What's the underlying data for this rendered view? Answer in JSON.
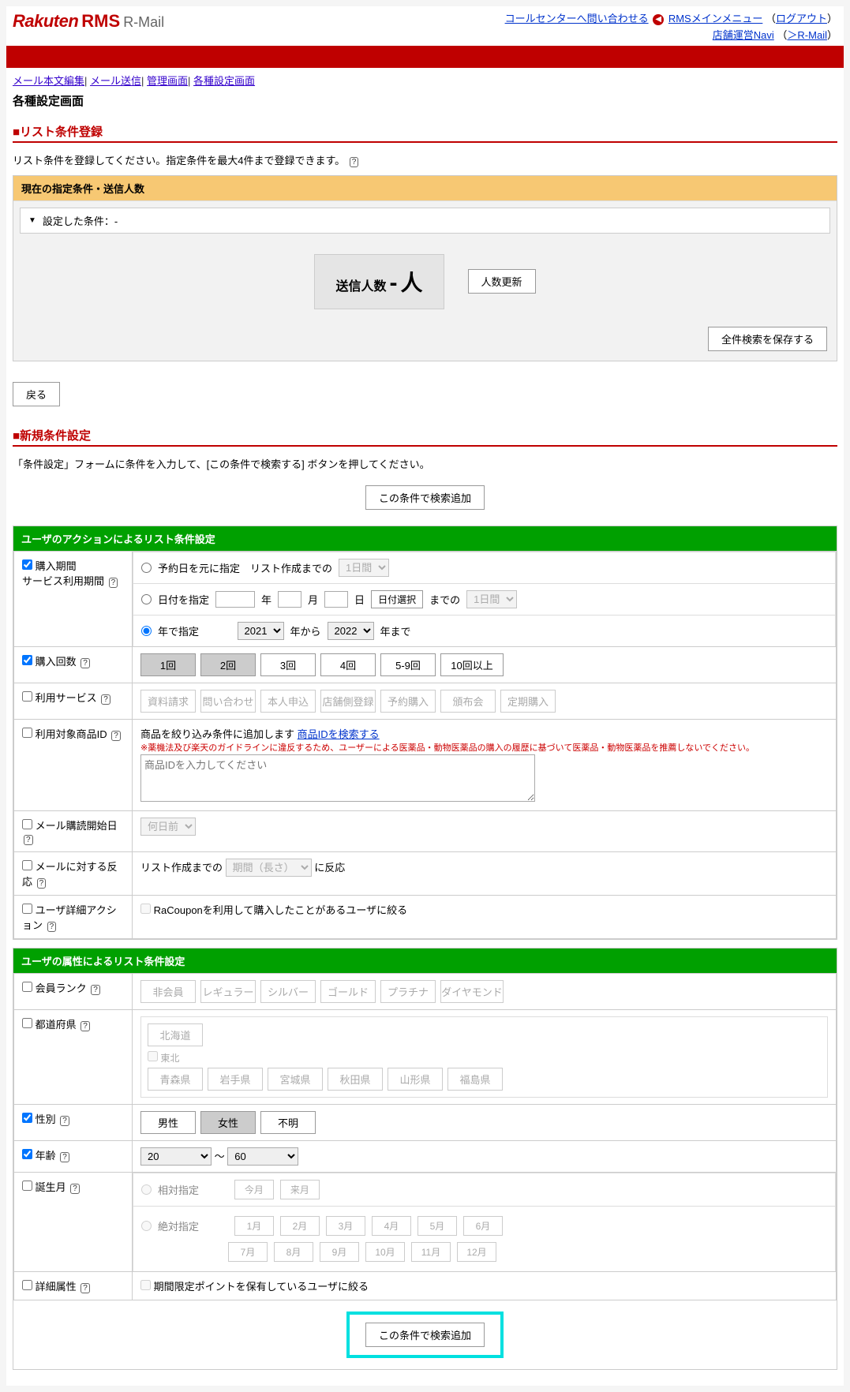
{
  "header": {
    "logo_main": "Rakuten",
    "logo_rms": "RMS",
    "logo_sub": "R-Mail",
    "link_call": "コールセンターへ問い合わせる",
    "link_menu": "RMSメインメニュー",
    "link_logout": "ログアウト",
    "link_navi": "店舗運営Navi",
    "link_rmail": "＞R-Mail"
  },
  "breadcrumb": {
    "b1": "メール本文編集",
    "b2": "メール送信",
    "b3": "管理画面",
    "b4": "各種設定画面"
  },
  "page_title": "各種設定画面",
  "sec1": {
    "title": "■リスト条件登録",
    "desc": "リスト条件を登録してください。指定条件を最大4件まで登録できます。",
    "panel_head": "現在の指定条件・送信人数",
    "cond_label": "設定した条件：-",
    "count_label": "送信人数",
    "count_value": "-",
    "count_unit": "人",
    "btn_update": "人数更新",
    "btn_save": "全件検索を保存する",
    "btn_back": "戻る"
  },
  "sec2": {
    "title": "■新規条件設定",
    "desc": "「条件設定」フォームに条件を入力して、[この条件で検索する] ボタンを押してください。",
    "btn_search": "この条件で検索追加"
  },
  "action_head": "ユーザのアクションによるリスト条件設定",
  "rows": {
    "r_period": "購入期間",
    "r_period_sub": "サービス利用期間",
    "p1_label": "予約日を元に指定　リスト作成までの",
    "p1_sel": "1日間",
    "p2_label": "日付を指定",
    "p2_y": "年",
    "p2_m": "月",
    "p2_d": "日",
    "p2_btn": "日付選択",
    "p2_until": "までの",
    "p2_sel": "1日間",
    "p3_label": "年で指定",
    "p3_y1": "2021",
    "p3_from": "年から",
    "p3_y2": "2022",
    "p3_to": "年まで",
    "r_count": "購入回数",
    "cnt": [
      "1回",
      "2回",
      "3回",
      "4回",
      "5-9回",
      "10回以上"
    ],
    "r_service": "利用サービス",
    "svc": [
      "資料請求",
      "問い合わせ",
      "本人申込",
      "店舗側登録",
      "予約購入",
      "頒布会",
      "定期購入"
    ],
    "r_product": "利用対象商品ID",
    "prod_desc": "商品を絞り込み条件に追加します",
    "prod_link": "商品IDを検索する",
    "prod_note": "※薬機法及び楽天のガイドラインに違反するため、ユーザーによる医薬品・動物医薬品の購入の履歴に基づいて医薬品・動物医薬品を推薦しないでください。",
    "prod_ph": "商品IDを入力してください",
    "r_mailstart": "メール購読開始日",
    "mailstart_sel": "何日前",
    "r_react": "メールに対する反応",
    "react_pre": "リスト作成までの",
    "react_sel": "期間（長さ）",
    "react_post": "に反応",
    "r_detail": "ユーザ詳細アクション",
    "detail_chk": "RaCouponを利用して購入したことがあるユーザに絞る"
  },
  "attr_head": "ユーザの属性によるリスト条件設定",
  "attr": {
    "r_rank": "会員ランク",
    "ranks": [
      "非会員",
      "レギュラー",
      "シルバー",
      "ゴールド",
      "プラチナ",
      "ダイヤモンド"
    ],
    "r_pref": "都道府県",
    "pref_top": "北海道",
    "pref_region": "東北",
    "pref_list": [
      "青森県",
      "岩手県",
      "宮城県",
      "秋田県",
      "山形県",
      "福島県"
    ],
    "r_gender": "性別",
    "genders": [
      "男性",
      "女性",
      "不明"
    ],
    "r_age": "年齢",
    "age_from": "20",
    "age_sep": "～",
    "age_to": "60",
    "r_birth": "誕生月",
    "birth_rel": "相対指定",
    "birth_rel_btns": [
      "今月",
      "来月"
    ],
    "birth_abs": "絶対指定",
    "months": [
      "1月",
      "2月",
      "3月",
      "4月",
      "5月",
      "6月",
      "7月",
      "8月",
      "9月",
      "10月",
      "11月",
      "12月"
    ],
    "r_detail": "詳細属性",
    "detail_chk": "期間限定ポイントを保有しているユーザに絞る"
  }
}
